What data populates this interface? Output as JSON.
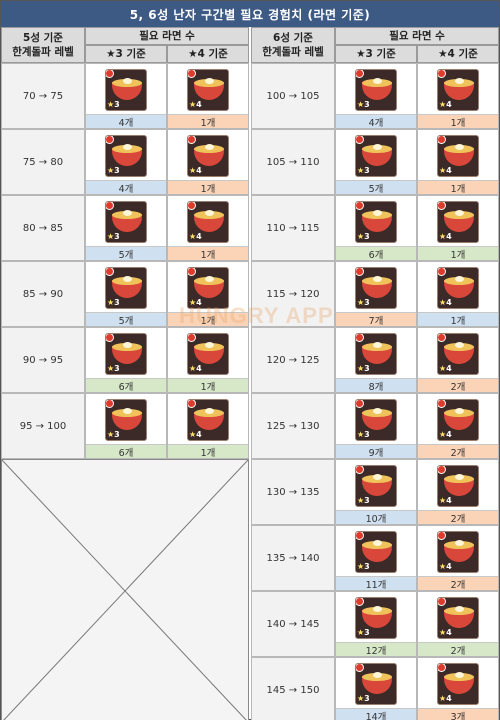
{
  "title": "5, 6성 난자 구간별 필요 경험치 (라면 기준)",
  "watermark": "HUNGRY APP",
  "left": {
    "header_level": "5성 기준\n한계돌파 레벨",
    "header_needed": "필요 라면 수",
    "header_star3": "★3 기준",
    "header_star4": "★4 기준",
    "rows": [
      {
        "level": "70 → 75",
        "star3": "4개",
        "star4": "1개",
        "c3": "blue",
        "c4": "orange"
      },
      {
        "level": "75 → 80",
        "star3": "4개",
        "star4": "1개",
        "c3": "blue",
        "c4": "orange"
      },
      {
        "level": "80 → 85",
        "star3": "5개",
        "star4": "1개",
        "c3": "blue",
        "c4": "orange"
      },
      {
        "level": "85 → 90",
        "star3": "5개",
        "star4": "1개",
        "c3": "blue",
        "c4": "orange"
      },
      {
        "level": "90 → 95",
        "star3": "6개",
        "star4": "1개",
        "c3": "green",
        "c4": "green"
      },
      {
        "level": "95 → 100",
        "star3": "6개",
        "star4": "1개",
        "c3": "green",
        "c4": "green"
      }
    ]
  },
  "right": {
    "header_level": "6성 기준\n한계돌파 레벨",
    "header_needed": "필요 라면 수",
    "header_star3": "★3 기준",
    "header_star4": "★4 기준",
    "rows": [
      {
        "level": "100 → 105",
        "star3": "4개",
        "star4": "1개",
        "c3": "blue",
        "c4": "orange"
      },
      {
        "level": "105 → 110",
        "star3": "5개",
        "star4": "1개",
        "c3": "blue",
        "c4": "orange"
      },
      {
        "level": "110 → 115",
        "star3": "6개",
        "star4": "1개",
        "c3": "green",
        "c4": "green"
      },
      {
        "level": "115 → 120",
        "star3": "7개",
        "star4": "1개",
        "c3": "orange",
        "c4": "blue"
      },
      {
        "level": "120 → 125",
        "star3": "8개",
        "star4": "2개",
        "c3": "blue",
        "c4": "orange"
      },
      {
        "level": "125 → 130",
        "star3": "9개",
        "star4": "2개",
        "c3": "blue",
        "c4": "orange"
      },
      {
        "level": "130 → 135",
        "star3": "10개",
        "star4": "2개",
        "c3": "blue",
        "c4": "orange"
      },
      {
        "level": "135 → 140",
        "star3": "11개",
        "star4": "2개",
        "c3": "blue",
        "c4": "orange"
      },
      {
        "level": "140 → 145",
        "star3": "12개",
        "star4": "2개",
        "c3": "green",
        "c4": "green"
      },
      {
        "level": "145 → 150",
        "star3": "14개",
        "star4": "3개",
        "c3": "blue",
        "c4": "orange"
      }
    ]
  },
  "icon": {
    "name": "ramen-icon",
    "grade3": "3",
    "grade4": "4",
    "star": "★"
  }
}
